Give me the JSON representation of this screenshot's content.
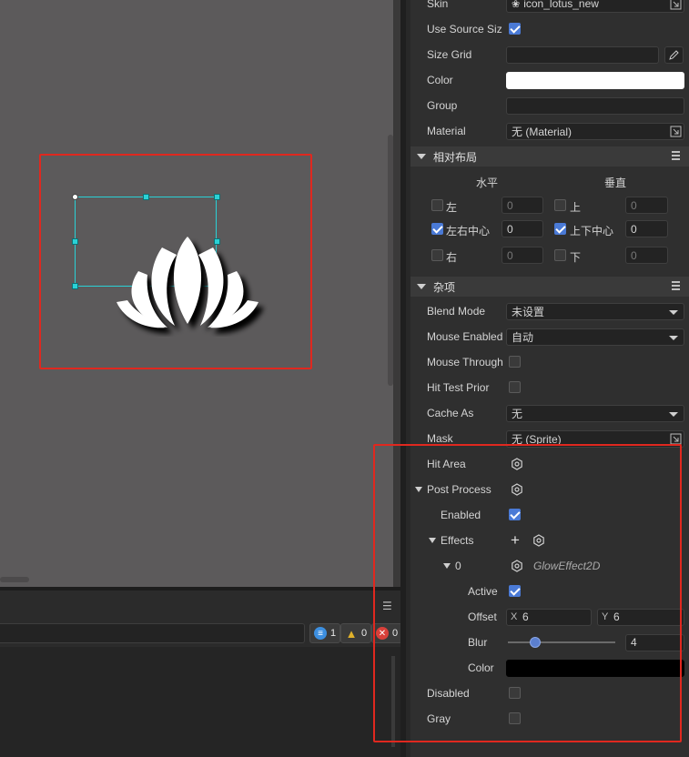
{
  "scene": {
    "colors": {
      "background": "#5c5a5b",
      "selection": "#2ad1d6",
      "highlight": "#e0281f"
    }
  },
  "console": {
    "menu_icon": "hamburger-icon",
    "badges": [
      {
        "icon": "info-filter-icon",
        "count": "1",
        "color": "#3d8fe0"
      },
      {
        "icon": "warning-icon",
        "count": "0",
        "color": "#e0b12a"
      },
      {
        "icon": "error-icon",
        "count": "0",
        "color": "#d9403a"
      }
    ]
  },
  "inspector": {
    "skin": {
      "label": "Skin",
      "value": "icon_lotus_new"
    },
    "use_source_size": {
      "label": "Use Source Siz",
      "checked": true
    },
    "size_grid": {
      "label": "Size Grid",
      "value": ""
    },
    "color": {
      "label": "Color",
      "value": "#ffffff"
    },
    "group": {
      "label": "Group",
      "value": ""
    },
    "material": {
      "label": "Material",
      "value": "无 (Material)"
    },
    "relative_layout": {
      "title": "相对布局",
      "horizontal": "水平",
      "vertical": "垂直",
      "left": {
        "label": "左",
        "checked": false,
        "value": "0"
      },
      "center_h": {
        "label": "左右中心",
        "checked": true,
        "value": "0"
      },
      "right": {
        "label": "右",
        "checked": false,
        "value": "0"
      },
      "top": {
        "label": "上",
        "checked": false,
        "value": "0"
      },
      "center_v": {
        "label": "上下中心",
        "checked": true,
        "value": "0"
      },
      "bottom": {
        "label": "下",
        "checked": false,
        "value": "0"
      }
    },
    "misc": {
      "title": "杂项",
      "blend_mode": {
        "label": "Blend Mode",
        "value": "未设置"
      },
      "mouse_enabled": {
        "label": "Mouse Enabled",
        "value": "自动"
      },
      "mouse_through": {
        "label": "Mouse Through",
        "checked": false
      },
      "hit_test_prior": {
        "label": "Hit Test Prior",
        "checked": false
      },
      "cache_as": {
        "label": "Cache As",
        "value": "无"
      },
      "mask": {
        "label": "Mask",
        "value": "无 (Sprite)"
      },
      "hit_area": {
        "label": "Hit Area"
      },
      "post_process": {
        "label": "Post Process"
      },
      "enabled": {
        "label": "Enabled",
        "checked": true
      },
      "effects": {
        "label": "Effects"
      },
      "effect_index": {
        "label": "0",
        "type": "GlowEffect2D"
      },
      "active": {
        "label": "Active",
        "checked": true
      },
      "offset": {
        "label": "Offset",
        "x_label": "X",
        "x": "6",
        "y_label": "Y",
        "y": "6"
      },
      "blur": {
        "label": "Blur",
        "value": "4",
        "fraction": 0.25
      },
      "glow_color": {
        "label": "Color",
        "value": "#000000"
      },
      "disabled": {
        "label": "Disabled",
        "checked": false
      },
      "gray": {
        "label": "Gray",
        "checked": false
      }
    }
  }
}
